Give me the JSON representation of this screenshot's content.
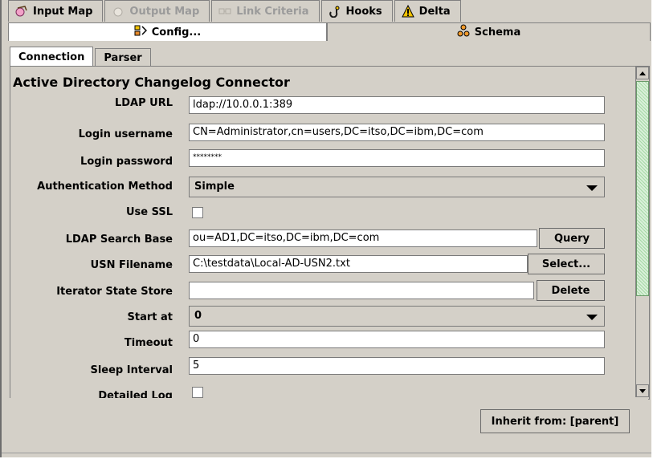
{
  "top_tabs": [
    {
      "label": "Input Map",
      "icon": "input-map-icon",
      "disabled": false
    },
    {
      "label": "Output Map",
      "icon": "output-map-icon",
      "disabled": true
    },
    {
      "label": "Link Criteria",
      "icon": "link-criteria-icon",
      "disabled": true
    },
    {
      "label": "Hooks",
      "icon": "hooks-icon",
      "disabled": false
    },
    {
      "label": "Delta",
      "icon": "delta-warning-icon",
      "disabled": false
    }
  ],
  "sub_tabs": {
    "config": "Config...",
    "schema": "Schema"
  },
  "inner_tabs": {
    "connection": "Connection",
    "parser": "Parser"
  },
  "panel": {
    "title": "Active Directory Changelog Connector"
  },
  "fields": {
    "ldap_url": {
      "label": "LDAP URL",
      "value": "ldap://10.0.0.1:389"
    },
    "login_username": {
      "label": "Login username",
      "value": "CN=Administrator,cn=users,DC=itso,DC=ibm,DC=com"
    },
    "login_password": {
      "label": "Login password",
      "value": "********"
    },
    "auth_method": {
      "label": "Authentication Method",
      "value": "Simple"
    },
    "use_ssl": {
      "label": "Use SSL"
    },
    "ldap_search_base": {
      "label": "LDAP Search Base",
      "value": "ou=AD1,DC=itso,DC=ibm,DC=com"
    },
    "usn_filename": {
      "label": "USN Filename",
      "value": "C:\\testdata\\Local-AD-USN2.txt"
    },
    "iterator_state_store": {
      "label": "Iterator State Store",
      "value": ""
    },
    "start_at": {
      "label": "Start at",
      "value": "0"
    },
    "timeout": {
      "label": "Timeout",
      "value": "0"
    },
    "sleep_interval": {
      "label": "Sleep Interval",
      "value": "5"
    },
    "detailed_log": {
      "label": "Detailed Log"
    }
  },
  "buttons": {
    "query": "Query",
    "select": "Select...",
    "delete": "Delete",
    "inherit": "Inherit from: [parent]"
  },
  "colors": {
    "panel_bg": "#d4d0c8",
    "scroll_thumb": "#a6d8a6",
    "warning_icon": "#f2c200"
  }
}
